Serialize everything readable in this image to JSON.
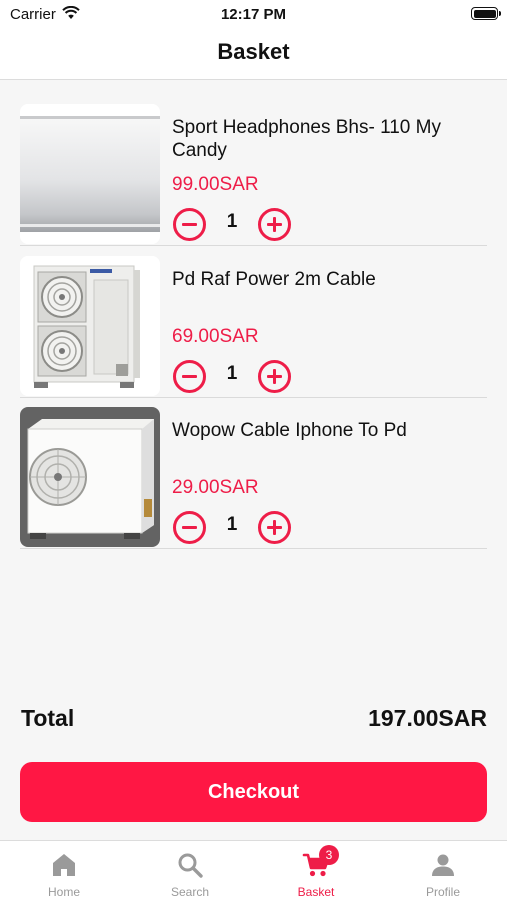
{
  "status_bar": {
    "carrier": "Carrier",
    "time": "12:17 PM"
  },
  "header": {
    "title": "Basket"
  },
  "basket": {
    "items": [
      {
        "name": "Sport Headphones Bhs- 110 My Candy",
        "price": "99.00SAR",
        "quantity": "1",
        "image": "air-conditioner-indoor-unit"
      },
      {
        "name": "Pd Raf Power 2m Cable",
        "price": "69.00SAR",
        "quantity": "1",
        "image": "air-conditioner-outdoor-unit-double-fan"
      },
      {
        "name": "Wopow Cable Iphone To Pd",
        "price": "29.00SAR",
        "quantity": "1",
        "image": "air-conditioner-outdoor-unit"
      }
    ]
  },
  "summary": {
    "total_label": "Total",
    "total_value": "197.00SAR"
  },
  "checkout": {
    "label": "Checkout"
  },
  "tab_bar": {
    "tabs": [
      {
        "label": "Home",
        "icon": "home-icon"
      },
      {
        "label": "Search",
        "icon": "search-icon"
      },
      {
        "label": "Basket",
        "icon": "cart-icon",
        "badge": "3",
        "active": true
      },
      {
        "label": "Profile",
        "icon": "person-icon"
      }
    ]
  },
  "colors": {
    "accent": "#ee1d48",
    "checkout_button": "#ff1744",
    "background": "#f6f6f6"
  }
}
